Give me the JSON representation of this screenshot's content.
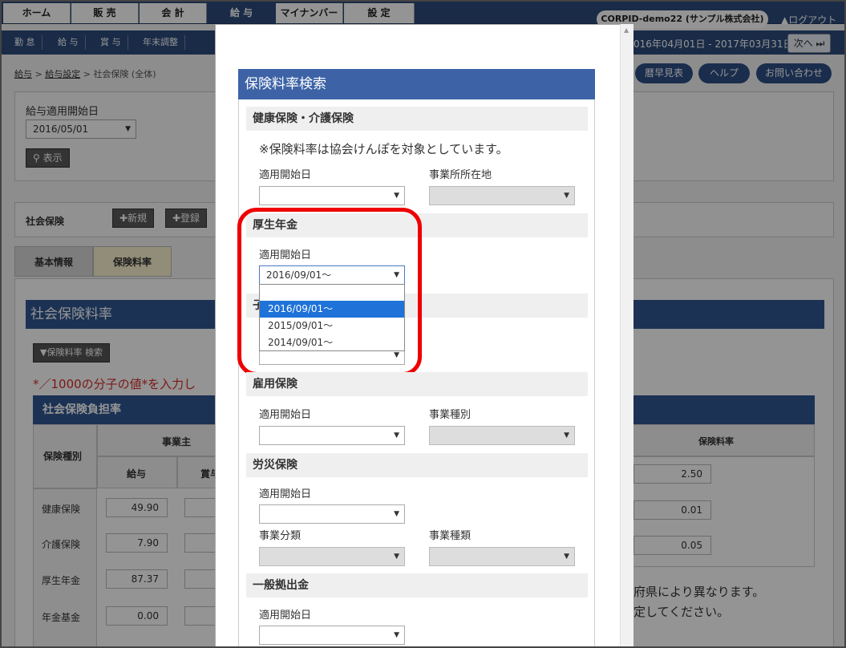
{
  "topnav": {
    "home": "ホーム",
    "sales": "販 売",
    "accounting": "会 計",
    "payroll": "給 与",
    "mynumber": "マイナンバー",
    "settings": "設 定",
    "company": "CORPID-demo22 (サンプル株式会社)",
    "logout": "▲ログアウト"
  },
  "subnav": {
    "attendance": "勤 怠",
    "pay": "給 与",
    "bonus": "賞 与",
    "yearend": "年末調整",
    "daterange": "016年04月01日 - 2017年03月31日",
    "next": "次へ ⏭"
  },
  "breadcrumb": {
    "a": "給与",
    "b": "給与設定",
    "c": "社会保険 (全体)",
    "sep": ">"
  },
  "topbuttons": {
    "calendar": "暦早見表",
    "help": "ヘルプ",
    "contact": "お問い合わせ"
  },
  "filter": {
    "label": "給与適用開始日",
    "value": "2016/05/01",
    "show": "⚲ 表示"
  },
  "section": {
    "title": "社会保険",
    "new": "✚新規",
    "register": "✚登録"
  },
  "tabs": {
    "basic": "基本情報",
    "rates": "保険料率"
  },
  "main": {
    "title": "社会保険料率",
    "search_btn": "▼保険料率 検索",
    "note": "*／1000の分子の値*を入力し",
    "table_title": "社会保険負担率",
    "col_type": "保険種別",
    "col_employer": "事業主",
    "col_salary": "給与",
    "col_bonus": "賞与",
    "col_rate": "保険料率",
    "rows": [
      {
        "name": "健康保険",
        "salary": "49.90",
        "rate": "2.50"
      },
      {
        "name": "介護保険",
        "salary": "7.90",
        "rate": "0.01"
      },
      {
        "name": "厚生年金",
        "salary": "87.37",
        "rate": "0.05"
      },
      {
        "name": "年金基金",
        "salary": "0.00",
        "rate": ""
      }
    ],
    "right_note1": "府県により異なります。",
    "right_note2": "定してください。"
  },
  "modal": {
    "title": "保険料率検索",
    "health": {
      "title": "健康保険・介護保険",
      "note": "※保険料率は協会けんぽを対象としています。",
      "start_label": "適用開始日",
      "loc_label": "事業所所在地"
    },
    "pension": {
      "title": "厚生年金",
      "start_label": "適用開始日",
      "value": "2016/09/01～",
      "options": [
        "2016/09/01～",
        "2015/09/01～",
        "2014/09/01～"
      ]
    },
    "child": {
      "title": "子"
    },
    "employment": {
      "title": "雇用保険",
      "start_label": "適用開始日",
      "type_label": "事業種別"
    },
    "accident": {
      "title": "労災保険",
      "start_label": "適用開始日",
      "class_label": "事業分類",
      "kind_label": "事業種類"
    },
    "contribution": {
      "title": "一般拠出金",
      "start_label": "適用開始日"
    }
  }
}
